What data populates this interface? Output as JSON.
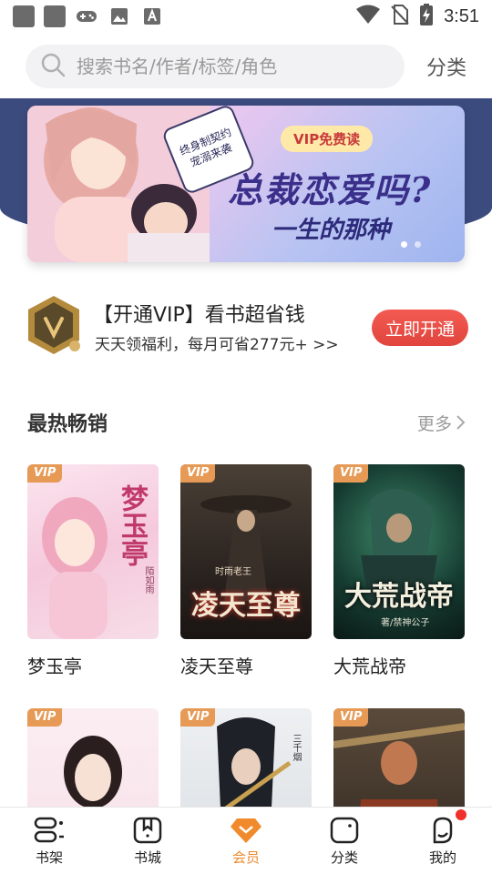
{
  "status_bar": {
    "time": "3:51"
  },
  "search": {
    "placeholder": "搜索书名/作者/标签/角色",
    "category_link": "分类"
  },
  "banner": {
    "badge": "VIP免费读",
    "title": "总裁恋爱吗?",
    "subtitle": "一生的那种",
    "bubble": "终身制契约宠溺来袭"
  },
  "vip_promo": {
    "title": "【开通VIP】看书超省钱",
    "desc": "天天领福利，每月可省277元+ >>",
    "button": "立即开通"
  },
  "section": {
    "title": "最热畅销",
    "more": "更多"
  },
  "books": [
    {
      "name": "梦玉亭",
      "vip": "VIP",
      "cover_text": "梦玉亭",
      "author_text": "陌如雨"
    },
    {
      "name": "凌天至尊",
      "vip": "VIP",
      "cover_text": "凌天至尊",
      "author_text": "时雨老王"
    },
    {
      "name": "大荒战帝",
      "vip": "VIP",
      "cover_text": "大荒战帝",
      "author_text": "著/禁神公子"
    },
    {
      "name": "",
      "vip": "VIP",
      "cover_text": "",
      "author_text": ""
    },
    {
      "name": "",
      "vip": "VIP",
      "cover_text": "",
      "author_text": "三千烟"
    },
    {
      "name": "",
      "vip": "VIP",
      "cover_text": "",
      "author_text": ""
    }
  ],
  "nav": [
    {
      "label": "书架",
      "icon": "bookshelf-icon"
    },
    {
      "label": "书城",
      "icon": "bookstore-icon"
    },
    {
      "label": "会员",
      "icon": "vip-diamond-icon",
      "active": true
    },
    {
      "label": "分类",
      "icon": "category-icon"
    },
    {
      "label": "我的",
      "icon": "profile-icon",
      "notification_dot": true
    }
  ],
  "colors": {
    "accent": "#f08a2c",
    "banner_bg": "#3c4b7e",
    "cta_red": "#e0443d",
    "vip_tag": "#e69a56"
  }
}
